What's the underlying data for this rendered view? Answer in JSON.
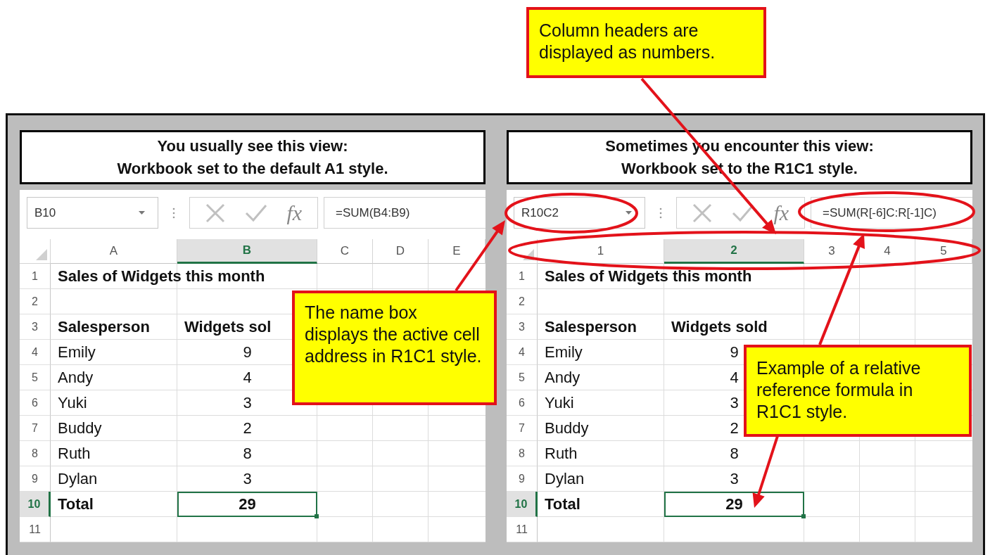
{
  "panels": [
    {
      "title_lines": [
        "You usually see this view:",
        "Workbook set to the default A1 style."
      ],
      "name_box": "B10",
      "function_label": "fx",
      "formula": "=SUM(B4:B9)",
      "columns": [
        {
          "label": "A",
          "selected": false
        },
        {
          "label": "B",
          "selected": true
        },
        {
          "label": "C",
          "selected": false
        },
        {
          "label": "D",
          "selected": false
        },
        {
          "label": "E",
          "selected": false
        }
      ],
      "rows": [
        {
          "label": "1",
          "kind": "title",
          "selected": false,
          "cells": [
            "Sales of Widgets this month"
          ]
        },
        {
          "label": "2",
          "kind": "empty",
          "selected": false,
          "cells": []
        },
        {
          "label": "3",
          "kind": "header",
          "selected": false,
          "cells": [
            "Salesperson",
            "Widgets sol"
          ]
        },
        {
          "label": "4",
          "kind": "data",
          "selected": false,
          "cells": [
            "Emily",
            "9"
          ]
        },
        {
          "label": "5",
          "kind": "data",
          "selected": false,
          "cells": [
            "Andy",
            "4"
          ]
        },
        {
          "label": "6",
          "kind": "data",
          "selected": false,
          "cells": [
            "Yuki",
            "3"
          ]
        },
        {
          "label": "7",
          "kind": "data",
          "selected": false,
          "cells": [
            "Buddy",
            "2"
          ]
        },
        {
          "label": "8",
          "kind": "data",
          "selected": false,
          "cells": [
            "Ruth",
            "8"
          ]
        },
        {
          "label": "9",
          "kind": "data",
          "selected": false,
          "cells": [
            "Dylan",
            "3"
          ]
        },
        {
          "label": "10",
          "kind": "total",
          "selected": true,
          "cells": [
            "Total",
            "29"
          ]
        },
        {
          "label": "11",
          "kind": "empty",
          "selected": false,
          "cells": []
        }
      ]
    },
    {
      "title_lines": [
        "Sometimes you encounter this view:",
        "Workbook set to the R1C1 style."
      ],
      "name_box": "R10C2",
      "function_label": "fx",
      "formula": "=SUM(R[-6]C:R[-1]C)",
      "columns": [
        {
          "label": "1",
          "selected": false
        },
        {
          "label": "2",
          "selected": true
        },
        {
          "label": "3",
          "selected": false
        },
        {
          "label": "4",
          "selected": false
        },
        {
          "label": "5",
          "selected": false
        }
      ],
      "rows": [
        {
          "label": "1",
          "kind": "title",
          "selected": false,
          "cells": [
            "Sales of Widgets this month"
          ]
        },
        {
          "label": "2",
          "kind": "empty",
          "selected": false,
          "cells": []
        },
        {
          "label": "3",
          "kind": "header",
          "selected": false,
          "cells": [
            "Salesperson",
            "Widgets sold"
          ]
        },
        {
          "label": "4",
          "kind": "data",
          "selected": false,
          "cells": [
            "Emily",
            "9"
          ]
        },
        {
          "label": "5",
          "kind": "data",
          "selected": false,
          "cells": [
            "Andy",
            "4"
          ]
        },
        {
          "label": "6",
          "kind": "data",
          "selected": false,
          "cells": [
            "Yuki",
            "3"
          ]
        },
        {
          "label": "7",
          "kind": "data",
          "selected": false,
          "cells": [
            "Buddy",
            "2"
          ]
        },
        {
          "label": "8",
          "kind": "data",
          "selected": false,
          "cells": [
            "Ruth",
            "8"
          ]
        },
        {
          "label": "9",
          "kind": "data",
          "selected": false,
          "cells": [
            "Dylan",
            "3"
          ]
        },
        {
          "label": "10",
          "kind": "total",
          "selected": true,
          "cells": [
            "Total",
            "29"
          ]
        },
        {
          "label": "11",
          "kind": "empty",
          "selected": false,
          "cells": []
        }
      ]
    }
  ],
  "callouts": [
    {
      "text": "Column headers are displayed as numbers."
    },
    {
      "text": "The name box displays the active cell address in R1C1 style."
    },
    {
      "text": "Example of a relative reference formula in R1C1 style."
    }
  ]
}
